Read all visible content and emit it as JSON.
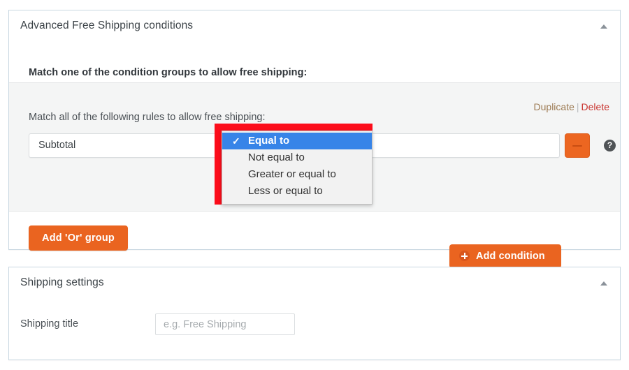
{
  "colors": {
    "accent_orange": "#ea6420",
    "highlight_blue": "#3784e8",
    "highlight_red": "#fc0d1b",
    "link_duplicate": "#9c7a52",
    "link_delete": "#c9342f",
    "panel_border": "#c8d7e1",
    "group_bg": "#f4f5f5"
  },
  "conditions_panel": {
    "title": "Advanced Free Shipping conditions",
    "collapse_icon": "caret-up-icon",
    "subheading": "Match one of the condition groups to allow free shipping:",
    "group": {
      "label": "Match all of the following rules to allow free shipping:",
      "duplicate_link": "Duplicate",
      "link_separator": "|",
      "delete_link": "Delete",
      "rule": {
        "field_value": "Subtotal",
        "operator_value": "Equal to",
        "value_value": "",
        "remove_icon": "minus-icon",
        "help_icon": "question-mark-icon"
      },
      "add_condition_button": "Add condition",
      "add_condition_icon": "circle-plus-icon"
    },
    "add_or_group_button": "Add 'Or' group"
  },
  "operator_dropdown": {
    "open": true,
    "check_glyph": "✓",
    "options": [
      {
        "label": "Equal to",
        "selected": true
      },
      {
        "label": "Not equal to",
        "selected": false
      },
      {
        "label": "Greater or equal to",
        "selected": false
      },
      {
        "label": "Less or equal to",
        "selected": false
      }
    ]
  },
  "shipping_panel": {
    "title": "Shipping settings",
    "collapse_icon": "caret-up-icon",
    "title_field_label": "Shipping title",
    "title_field_value": "",
    "title_field_placeholder": "e.g. Free Shipping"
  }
}
